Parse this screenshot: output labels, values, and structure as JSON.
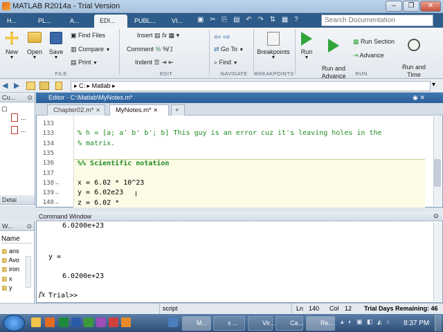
{
  "window": {
    "title": "MATLAB R2014a - Trial Version",
    "minimize": "–",
    "restore": "❐",
    "close": "✕"
  },
  "tabs": [
    "H...",
    "PL...",
    "A...",
    "EDI...",
    "PUBL...",
    "VI..."
  ],
  "search_placeholder": "Search Documentation",
  "ribbon": {
    "file": {
      "new": "New",
      "open": "Open",
      "save": "Save",
      "find_files": "Find Files",
      "compare": "Compare",
      "print": "Print",
      "label": "FILE"
    },
    "edit": {
      "insert": "Insert",
      "comment": "Comment",
      "indent": "Indent",
      "label": "EDIT"
    },
    "navigate": {
      "goto": "Go To",
      "find": "Find",
      "label": "NAVIGATE"
    },
    "breakpoints": {
      "breakpoints": "Breakpoints",
      "label": "BREAKPOINTS"
    },
    "run": {
      "run": "Run",
      "run_advance": "Run and\nAdvance",
      "run_section": "Run Section",
      "advance": "Advance",
      "run_time": "Run and\nTime",
      "label": "RUN"
    }
  },
  "address": {
    "drive": "C:",
    "folder": "Matlab"
  },
  "current_folder_header": "Cu...",
  "details_header": "Detai",
  "workspace": {
    "header": "W...",
    "name_col": "Name",
    "vars": [
      "ans",
      "Avo",
      "iron",
      "x",
      "y"
    ]
  },
  "editor": {
    "title": "Editor - C:\\Matlab\\MyNotes.m*",
    "tabs": [
      "Chapter02.m*",
      "MyNotes.m*"
    ],
    "add_tab": "+",
    "lines": [
      {
        "num": "133",
        "text": "% h = [a; a' b' b'; b] This guy is an error cuz it's leaving holes in the",
        "comment": true
      },
      {
        "num": "134",
        "text": "% matrix.",
        "comment": true
      },
      {
        "num": "135",
        "text": "",
        "comment": false
      },
      {
        "num": "136",
        "text": "%% Scientific notation",
        "comment": true
      },
      {
        "num": "137",
        "text": "",
        "comment": false
      },
      {
        "num": "138",
        "text": "x = 6.02 * 10^23",
        "comment": false
      },
      {
        "num": "139",
        "text": "y = 6.02e23",
        "comment": false
      },
      {
        "num": "140",
        "text": "z = 6.02 *",
        "comment": false
      }
    ]
  },
  "command_window": {
    "header": "Command Window",
    "out1": "6.0200e+23",
    "yeq": "y =",
    "out2": "6.0200e+23",
    "prompt": "Trial>>",
    "fx": "fx"
  },
  "status": {
    "mode": "script",
    "ln_label": "Ln",
    "ln": "140",
    "col_label": "Col",
    "col": "12",
    "trial": "Trial Days Remaining: 46"
  },
  "taskbar": {
    "items": [
      "M...",
      "x ...",
      "Vir...",
      "Ca...",
      "Re..."
    ],
    "time": "8:37 PM"
  }
}
